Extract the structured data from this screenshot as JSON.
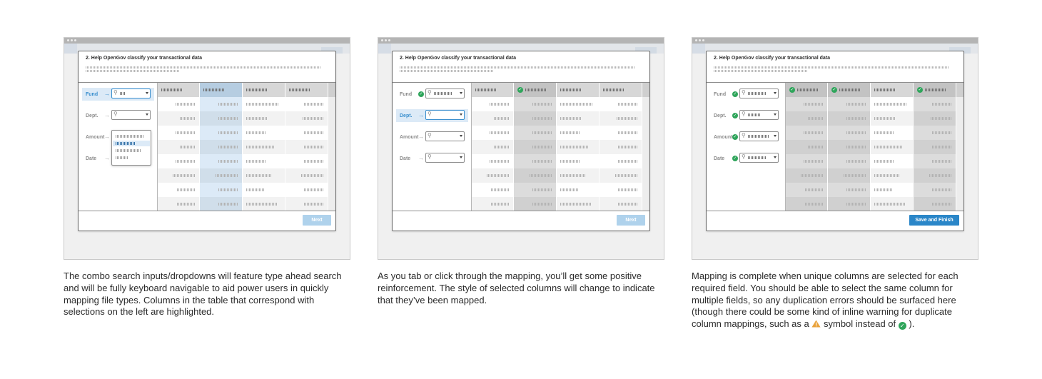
{
  "modal": {
    "title": "2. Help OpenGov classify your transactional data"
  },
  "fields": [
    {
      "label": "Fund"
    },
    {
      "label": "Dept."
    },
    {
      "label": "Amount"
    },
    {
      "label": "Date"
    }
  ],
  "glyphs": {
    "arrow": "→",
    "search": "⚲",
    "check": "✓"
  },
  "buttons": {
    "next": "Next",
    "save_finish": "Save and Finish"
  },
  "icons": {
    "warning": "warning-triangle-icon",
    "ok": "green-check-icon"
  },
  "colors": {
    "accent": "#2a86c8",
    "highlight": "#dceaf7",
    "success": "#2fa55b",
    "warning": "#e9a23b"
  },
  "panels": [
    {
      "state": "Fund field focused; combo search dropdown open; corresponding table column highlighted",
      "active_field": "Fund",
      "dropdown_open": true
    },
    {
      "state": "Fund mapped with check; Dept. field focused; mapped column shaded",
      "active_field": "Dept.",
      "dropdown_open": false
    },
    {
      "state": "All four fields mapped; Save and Finish enabled",
      "active_field": null,
      "dropdown_open": false
    }
  ],
  "captions": {
    "p1": "The combo search inputs/dropdowns will feature type ahead search and will be fully keyboard navigable to aid power users in quickly mapping file types. Columns in the table that correspond with selections on the left are highlighted.",
    "p2": "As you tab or click through the mapping, you’ll get some positive reinforcement. The style of selected columns will change to indicate that they’ve been mapped.",
    "p3_before": "Mapping is complete when unique columns are selected for each required field. You should be able to select the same column for multiple fields, so any duplication errors should be surfaced here (though there could be some kind of inline warning for duplicate column mappings, such as a ",
    "p3_middle": " symbol instead of ",
    "p3_after": " )."
  }
}
